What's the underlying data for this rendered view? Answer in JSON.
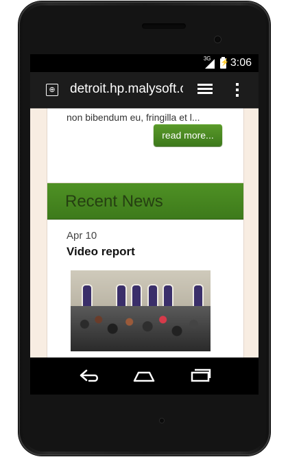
{
  "status_bar": {
    "network": "3G",
    "time": "3:06"
  },
  "browser": {
    "url": "detroit.hp.malysoft.c"
  },
  "page": {
    "teaser_text": "non bibendum eu, fringilla et l...",
    "read_more_label": "read more...",
    "recent_news": {
      "title": "Recent News",
      "date": "Apr 10",
      "headline": "Video report"
    }
  },
  "icons": {
    "globe": "globe-icon",
    "tabs": "tabs-icon",
    "menu": "overflow-menu-icon",
    "back": "back-icon",
    "home": "home-icon",
    "recents": "recent-apps-icon"
  },
  "colors": {
    "page_bg": "#f8ede2",
    "green_header": "#4f9124",
    "button_green": "#3d7a1b"
  }
}
